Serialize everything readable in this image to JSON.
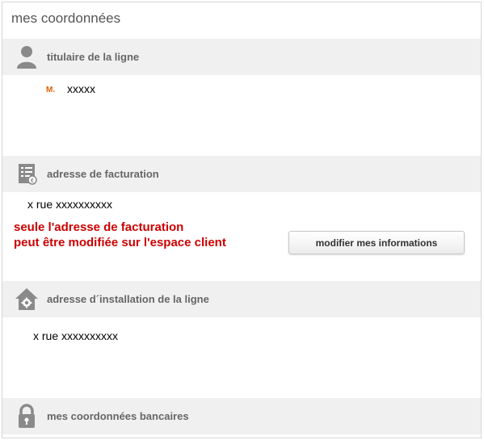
{
  "page_title": "mes coordonnées",
  "sections": {
    "holder": {
      "label": "titulaire de la ligne",
      "civility": "M.",
      "name": "xxxxx"
    },
    "billing": {
      "label": "adresse de facturation",
      "address": "x rue xxxxxxxxxx",
      "notice_line1": "seule l'adresse de facturation",
      "notice_line2": "peut être modifiée sur l'espace client",
      "button_label": "modifier mes informations"
    },
    "installation": {
      "label": "adresse d´installation de la ligne",
      "address": "x rue xxxxxxxxxx"
    },
    "bank": {
      "label": "mes coordonnées bancaires"
    }
  },
  "icons": {
    "holder": "person-icon",
    "billing": "invoice-icon",
    "installation": "house-gear-icon",
    "bank": "padlock-icon"
  },
  "colors": {
    "notice": "#cc0000",
    "civility": "#e06000",
    "band": "#f0f0f0",
    "icon": "#8a8a8a"
  }
}
